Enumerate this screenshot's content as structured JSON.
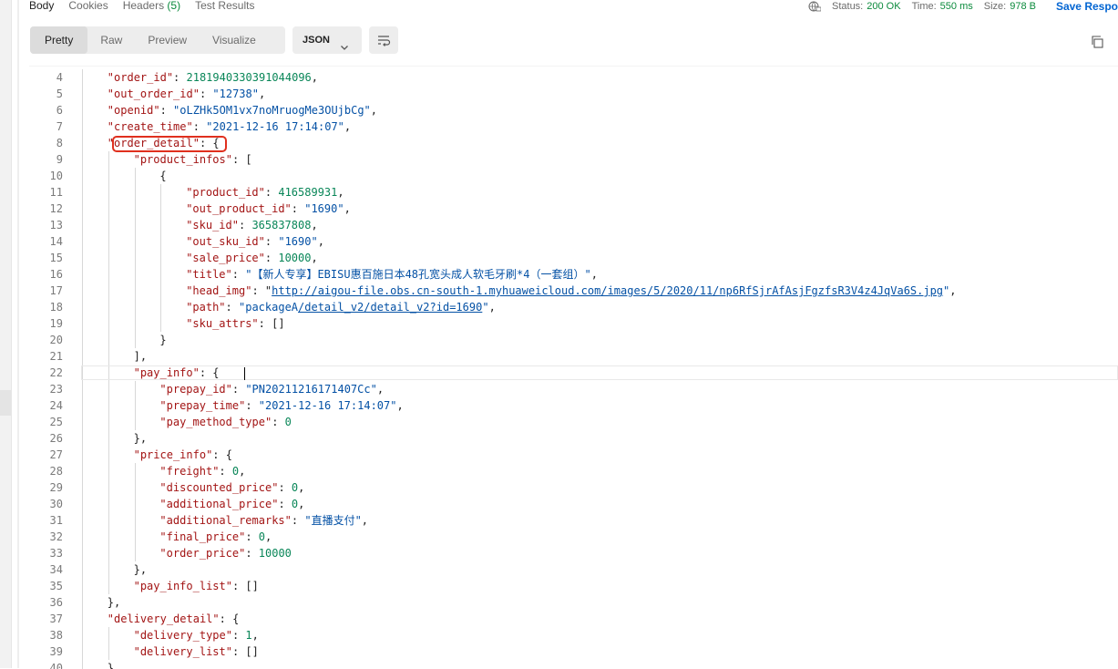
{
  "tabs": {
    "body": "Body",
    "cookies": "Cookies",
    "headers": "Headers",
    "headers_count": "(5)",
    "test_results": "Test Results"
  },
  "status": {
    "status_label": "Status:",
    "status_value": "200 OK",
    "time_label": "Time:",
    "time_value": "550 ms",
    "size_label": "Size:",
    "size_value": "978 B",
    "save_label": "Save Respo"
  },
  "toolbar": {
    "pretty": "Pretty",
    "raw": "Raw",
    "preview": "Preview",
    "visualize": "Visualize",
    "format": "JSON"
  },
  "colors": {
    "key": "#a31515",
    "string": "#0451a5",
    "number": "#098658",
    "status_ok": "#0b8a3c",
    "accent": "#0265d2",
    "annotation": "#e0301e"
  },
  "icons": [
    "globe-icon",
    "chevron-down-icon",
    "wrap-lines-icon",
    "copy-icon"
  ],
  "code_lines": [
    {
      "n": "4",
      "indent": 1,
      "parts": [
        {
          "t": "\"order_id\"",
          "c": "k"
        },
        {
          "t": ": "
        },
        {
          "t": "2181940330391044096",
          "c": "n"
        },
        {
          "t": ","
        }
      ]
    },
    {
      "n": "5",
      "indent": 1,
      "parts": [
        {
          "t": "\"out_order_id\"",
          "c": "k"
        },
        {
          "t": ": "
        },
        {
          "t": "\"12738\"",
          "c": "s"
        },
        {
          "t": ","
        }
      ]
    },
    {
      "n": "6",
      "indent": 1,
      "parts": [
        {
          "t": "\"openid\"",
          "c": "k"
        },
        {
          "t": ": "
        },
        {
          "t": "\"oLZHk5OM1vx7noMruogMe3OUjbCg\"",
          "c": "s"
        },
        {
          "t": ","
        }
      ]
    },
    {
      "n": "7",
      "indent": 1,
      "parts": [
        {
          "t": "\"create_time\"",
          "c": "k"
        },
        {
          "t": ": "
        },
        {
          "t": "\"2021-12-16 17:14:07\"",
          "c": "s"
        },
        {
          "t": ","
        }
      ]
    },
    {
      "n": "8",
      "indent": 1,
      "parts": [
        {
          "t": "\"order_detail\"",
          "c": "k"
        },
        {
          "t": ": {"
        }
      ]
    },
    {
      "n": "9",
      "indent": 2,
      "parts": [
        {
          "t": "\"product_infos\"",
          "c": "k"
        },
        {
          "t": ": ["
        }
      ]
    },
    {
      "n": "10",
      "indent": 3,
      "parts": [
        {
          "t": "{"
        }
      ]
    },
    {
      "n": "11",
      "indent": 4,
      "parts": [
        {
          "t": "\"product_id\"",
          "c": "k"
        },
        {
          "t": ": "
        },
        {
          "t": "416589931",
          "c": "n"
        },
        {
          "t": ","
        }
      ]
    },
    {
      "n": "12",
      "indent": 4,
      "parts": [
        {
          "t": "\"out_product_id\"",
          "c": "k"
        },
        {
          "t": ": "
        },
        {
          "t": "\"1690\"",
          "c": "s"
        },
        {
          "t": ","
        }
      ]
    },
    {
      "n": "13",
      "indent": 4,
      "parts": [
        {
          "t": "\"sku_id\"",
          "c": "k"
        },
        {
          "t": ": "
        },
        {
          "t": "365837808",
          "c": "n"
        },
        {
          "t": ","
        }
      ]
    },
    {
      "n": "14",
      "indent": 4,
      "parts": [
        {
          "t": "\"out_sku_id\"",
          "c": "k"
        },
        {
          "t": ": "
        },
        {
          "t": "\"1690\"",
          "c": "s"
        },
        {
          "t": ","
        }
      ]
    },
    {
      "n": "15",
      "indent": 4,
      "parts": [
        {
          "t": "\"sale_price\"",
          "c": "k"
        },
        {
          "t": ": "
        },
        {
          "t": "10000",
          "c": "n"
        },
        {
          "t": ","
        }
      ]
    },
    {
      "n": "16",
      "indent": 4,
      "parts": [
        {
          "t": "\"title\"",
          "c": "k"
        },
        {
          "t": ": "
        },
        {
          "t": "\"【新人专享】EBISU惠百施日本48孔宽头成人软毛牙刷*4（一套组）\"",
          "c": "s"
        },
        {
          "t": ","
        }
      ]
    },
    {
      "n": "17",
      "indent": 4,
      "parts": [
        {
          "t": "\"head_img\"",
          "c": "k"
        },
        {
          "t": ": "
        },
        {
          "t": "\""
        },
        {
          "t": "http://aigou-file.obs.cn-south-1.myhuaweicloud.com/images/5/2020/11/np6RfSjrAfAsjFgzfsR3V4z4JqVa6S.jpg",
          "c": "lnk"
        },
        {
          "t": "\"",
          "c": "s"
        },
        {
          "t": ","
        }
      ]
    },
    {
      "n": "18",
      "indent": 4,
      "parts": [
        {
          "t": "\"path\"",
          "c": "k"
        },
        {
          "t": ": "
        },
        {
          "t": "\"packageA",
          "c": "s"
        },
        {
          "t": "/detail_v2/detail_v2?id=1690",
          "c": "lnk"
        },
        {
          "t": "\"",
          "c": "s"
        },
        {
          "t": ","
        }
      ]
    },
    {
      "n": "19",
      "indent": 4,
      "parts": [
        {
          "t": "\"sku_attrs\"",
          "c": "k"
        },
        {
          "t": ": []"
        }
      ]
    },
    {
      "n": "20",
      "indent": 3,
      "parts": [
        {
          "t": "}"
        }
      ]
    },
    {
      "n": "21",
      "indent": 2,
      "parts": [
        {
          "t": "],"
        }
      ]
    },
    {
      "n": "22",
      "indent": 2,
      "parts": [
        {
          "t": "\"pay_info\"",
          "c": "k"
        },
        {
          "t": ": {"
        }
      ]
    },
    {
      "n": "23",
      "indent": 3,
      "parts": [
        {
          "t": "\"prepay_id\"",
          "c": "k"
        },
        {
          "t": ": "
        },
        {
          "t": "\"PN20211216171407Cc\"",
          "c": "s"
        },
        {
          "t": ","
        }
      ]
    },
    {
      "n": "24",
      "indent": 3,
      "parts": [
        {
          "t": "\"prepay_time\"",
          "c": "k"
        },
        {
          "t": ": "
        },
        {
          "t": "\"2021-12-16 17:14:07\"",
          "c": "s"
        },
        {
          "t": ","
        }
      ]
    },
    {
      "n": "25",
      "indent": 3,
      "parts": [
        {
          "t": "\"pay_method_type\"",
          "c": "k"
        },
        {
          "t": ": "
        },
        {
          "t": "0",
          "c": "n"
        }
      ]
    },
    {
      "n": "26",
      "indent": 2,
      "parts": [
        {
          "t": "},"
        }
      ]
    },
    {
      "n": "27",
      "indent": 2,
      "parts": [
        {
          "t": "\"price_info\"",
          "c": "k"
        },
        {
          "t": ": {"
        }
      ]
    },
    {
      "n": "28",
      "indent": 3,
      "parts": [
        {
          "t": "\"freight\"",
          "c": "k"
        },
        {
          "t": ": "
        },
        {
          "t": "0",
          "c": "n"
        },
        {
          "t": ","
        }
      ]
    },
    {
      "n": "29",
      "indent": 3,
      "parts": [
        {
          "t": "\"discounted_price\"",
          "c": "k"
        },
        {
          "t": ": "
        },
        {
          "t": "0",
          "c": "n"
        },
        {
          "t": ","
        }
      ]
    },
    {
      "n": "30",
      "indent": 3,
      "parts": [
        {
          "t": "\"additional_price\"",
          "c": "k"
        },
        {
          "t": ": "
        },
        {
          "t": "0",
          "c": "n"
        },
        {
          "t": ","
        }
      ]
    },
    {
      "n": "31",
      "indent": 3,
      "parts": [
        {
          "t": "\"additional_remarks\"",
          "c": "k"
        },
        {
          "t": ": "
        },
        {
          "t": "\"直播支付\"",
          "c": "s"
        },
        {
          "t": ","
        }
      ]
    },
    {
      "n": "32",
      "indent": 3,
      "parts": [
        {
          "t": "\"final_price\"",
          "c": "k"
        },
        {
          "t": ": "
        },
        {
          "t": "0",
          "c": "n"
        },
        {
          "t": ","
        }
      ]
    },
    {
      "n": "33",
      "indent": 3,
      "parts": [
        {
          "t": "\"order_price\"",
          "c": "k"
        },
        {
          "t": ": "
        },
        {
          "t": "10000",
          "c": "n"
        }
      ]
    },
    {
      "n": "34",
      "indent": 2,
      "parts": [
        {
          "t": "},"
        }
      ]
    },
    {
      "n": "35",
      "indent": 2,
      "parts": [
        {
          "t": "\"pay_info_list\"",
          "c": "k"
        },
        {
          "t": ": []"
        }
      ]
    },
    {
      "n": "36",
      "indent": 1,
      "parts": [
        {
          "t": "},"
        }
      ]
    },
    {
      "n": "37",
      "indent": 1,
      "parts": [
        {
          "t": "\"delivery_detail\"",
          "c": "k"
        },
        {
          "t": ": {"
        }
      ]
    },
    {
      "n": "38",
      "indent": 2,
      "parts": [
        {
          "t": "\"delivery_type\"",
          "c": "k"
        },
        {
          "t": ": "
        },
        {
          "t": "1",
          "c": "n"
        },
        {
          "t": ","
        }
      ]
    },
    {
      "n": "39",
      "indent": 2,
      "parts": [
        {
          "t": "\"delivery_list\"",
          "c": "k"
        },
        {
          "t": ": []"
        }
      ]
    },
    {
      "n": "40",
      "indent": 1,
      "parts": [
        {
          "t": "},"
        }
      ]
    }
  ]
}
